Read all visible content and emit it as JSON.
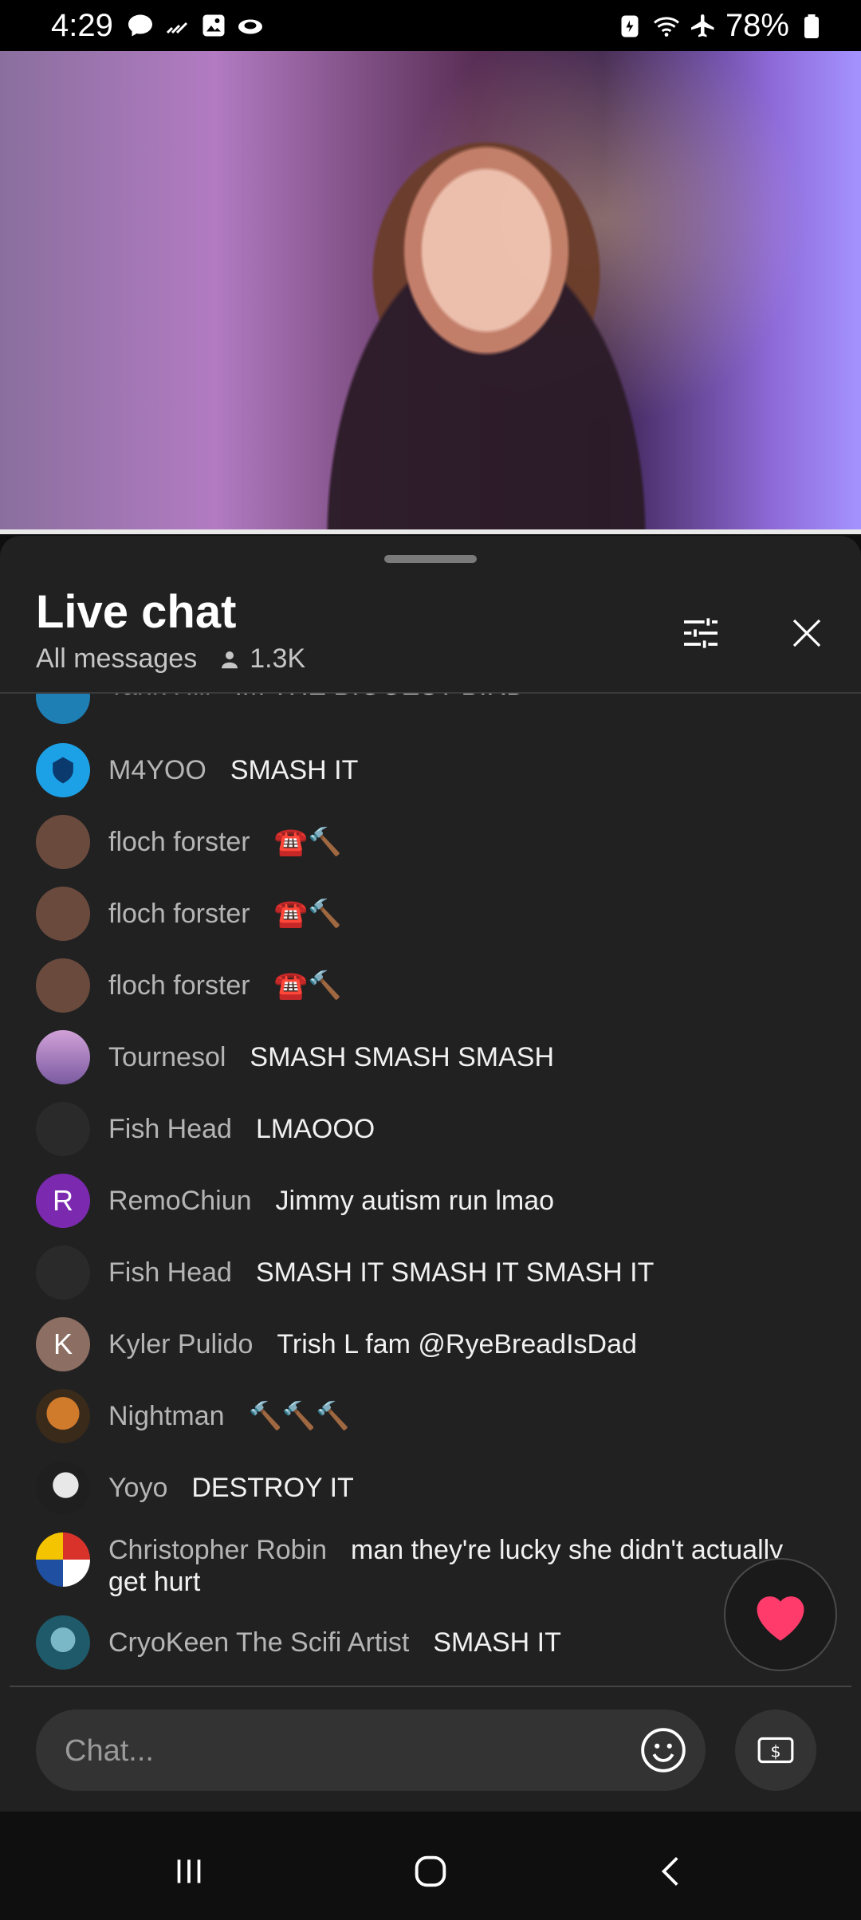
{
  "status_bar": {
    "time": "4:29",
    "battery": "78%"
  },
  "video": {
    "progress": 1.0
  },
  "header": {
    "title": "Live chat",
    "filter_label": "All messages",
    "viewer_count": "1.3K"
  },
  "messages": [
    {
      "author": "Tank Hill",
      "text": "IM THE BIGGEST BIRD",
      "avatar_color": "#1e7fb5"
    },
    {
      "author": "M4YOO",
      "text": "SMASH IT",
      "avatar_color": "#1da1e6"
    },
    {
      "author": "floch forster",
      "text": "☎️🔨",
      "avatar_color": "#6b4a3e"
    },
    {
      "author": "floch forster",
      "text": "☎️🔨",
      "avatar_color": "#6b4a3e"
    },
    {
      "author": "floch forster",
      "text": "☎️🔨",
      "avatar_color": "#6b4a3e"
    },
    {
      "author": "Tournesol",
      "text": "SMASH SMASH SMASH",
      "avatar_color": "#b07bd2"
    },
    {
      "author": "Fish Head",
      "text": "LMAOOO",
      "avatar_color": "#2a2a2a"
    },
    {
      "author": "RemoChiun",
      "text": "Jimmy autism run lmao",
      "avatar_color": "#7b2ab0",
      "avatar_letter": "R"
    },
    {
      "author": "Fish Head",
      "text": "SMASH IT SMASH IT SMASH IT",
      "avatar_color": "#2a2a2a"
    },
    {
      "author": "Kyler Pulido",
      "text": "Trish L fam @RyeBreadIsDad",
      "avatar_color": "#8d6e63",
      "avatar_letter": "K"
    },
    {
      "author": "Nightman",
      "text": "🔨🔨🔨",
      "avatar_color": "#3a2a1a"
    },
    {
      "author": "Yoyo",
      "text": "DESTROY IT",
      "avatar_color": "#1f1f1f"
    },
    {
      "author": "Christopher Robin",
      "text": "man they're lucky she didn't actually get hurt",
      "avatar_color": "#ffffff"
    },
    {
      "author": "CryoKeen The Scifi Artist",
      "text": "SMASH IT",
      "avatar_color": "#1f5a6a"
    }
  ],
  "chat_input": {
    "placeholder": "Chat..."
  },
  "colors": {
    "heart": "#ff3b6b",
    "sheet_bg": "#212121"
  }
}
